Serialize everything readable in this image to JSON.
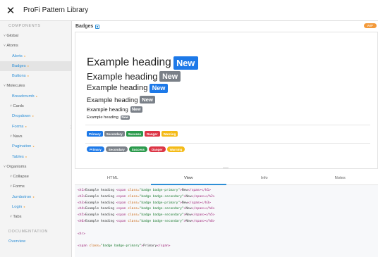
{
  "app": {
    "title": "ProFi Pattern Library",
    "close_glyph": "✕"
  },
  "sidebar": {
    "sections": [
      {
        "heading": "COMPONENTS"
      },
      {
        "heading": "DOCUMENTATION"
      }
    ],
    "items": [
      {
        "label": "Global",
        "type": "group",
        "level": 0
      },
      {
        "label": "Atoms",
        "type": "group",
        "level": 0
      },
      {
        "label": "Alerts",
        "type": "link",
        "level": 1
      },
      {
        "label": "Badges",
        "type": "link",
        "level": 1,
        "active": true
      },
      {
        "label": "Buttons",
        "type": "link",
        "level": 1
      },
      {
        "label": "Molecules",
        "type": "group",
        "level": 0
      },
      {
        "label": "Breadcrumb",
        "type": "link",
        "level": 1
      },
      {
        "label": "Cards",
        "type": "group",
        "level": 1
      },
      {
        "label": "Dropdown",
        "type": "link",
        "level": 1
      },
      {
        "label": "Forms",
        "type": "link",
        "level": 1
      },
      {
        "label": "Navs",
        "type": "group",
        "level": 1
      },
      {
        "label": "Pagination",
        "type": "link",
        "level": 1
      },
      {
        "label": "Tables",
        "type": "link",
        "level": 1
      },
      {
        "label": "Organisms",
        "type": "group",
        "level": 0
      },
      {
        "label": "Collapse",
        "type": "group",
        "level": 1
      },
      {
        "label": "Forms",
        "type": "group",
        "level": 1
      },
      {
        "label": "Jumbotron",
        "type": "link",
        "level": 1
      },
      {
        "label": "Login",
        "type": "link",
        "level": 1
      },
      {
        "label": "Tabs",
        "type": "group",
        "level": 1
      }
    ],
    "doc_items": [
      {
        "label": "Overview",
        "type": "link"
      }
    ]
  },
  "main": {
    "title": "Badges",
    "status_badge": "WIP",
    "headings": [
      {
        "text": "Example heading",
        "badge": "New",
        "variant": "primary"
      },
      {
        "text": "Example heading",
        "badge": "New",
        "variant": "secondary"
      },
      {
        "text": "Example heading",
        "badge": "New",
        "variant": "primary"
      },
      {
        "text": "Example heading",
        "badge": "New",
        "variant": "secondary"
      },
      {
        "text": "Example heading",
        "badge": "New",
        "variant": "secondary"
      },
      {
        "text": "Example heading",
        "badge": "New",
        "variant": "secondary"
      }
    ],
    "badge_row": [
      {
        "label": "Primary",
        "variant": "primary"
      },
      {
        "label": "Secondary",
        "variant": "secondary"
      },
      {
        "label": "Success",
        "variant": "success"
      },
      {
        "label": "Danger",
        "variant": "danger"
      },
      {
        "label": "Warning",
        "variant": "warning"
      }
    ],
    "pill_row": [
      {
        "label": "Primary",
        "variant": "primary"
      },
      {
        "label": "Secondary",
        "variant": "secondary"
      },
      {
        "label": "Success",
        "variant": "success"
      },
      {
        "label": "Danger",
        "variant": "danger"
      },
      {
        "label": "Warning",
        "variant": "warning"
      }
    ],
    "tabs": [
      {
        "label": "HTML",
        "active": false
      },
      {
        "label": "View",
        "active": true
      },
      {
        "label": "Info",
        "active": false
      },
      {
        "label": "Notes",
        "active": false
      }
    ],
    "code_lines": [
      {
        "tag": "h1",
        "cls": "badge badge-primary"
      },
      {
        "tag": "h2",
        "cls": "badge badge-secondary"
      },
      {
        "tag": "h3",
        "cls": "badge badge-primary"
      },
      {
        "tag": "h4",
        "cls": "badge badge-secondary"
      },
      {
        "tag": "h5",
        "cls": "badge badge-secondary"
      },
      {
        "tag": "h6",
        "cls": "badge badge-secondary"
      }
    ],
    "code_heading_text": "Example heading",
    "code_badge_text": "New",
    "code_hr": "<hr>",
    "code_last": {
      "cls": "badge badge-primary",
      "text": "Primary"
    }
  },
  "colors": {
    "primary": "#1d79e8",
    "secondary": "#7a8088",
    "success": "#2b9a4c",
    "danger": "#dc3545",
    "warning": "#f4bb17",
    "link": "#2e8fd6",
    "wip": "#f39a3b"
  },
  "icons": {
    "close": "close-icon",
    "view_toggle": "panel-icon",
    "resize": "resize-handle-icon"
  }
}
